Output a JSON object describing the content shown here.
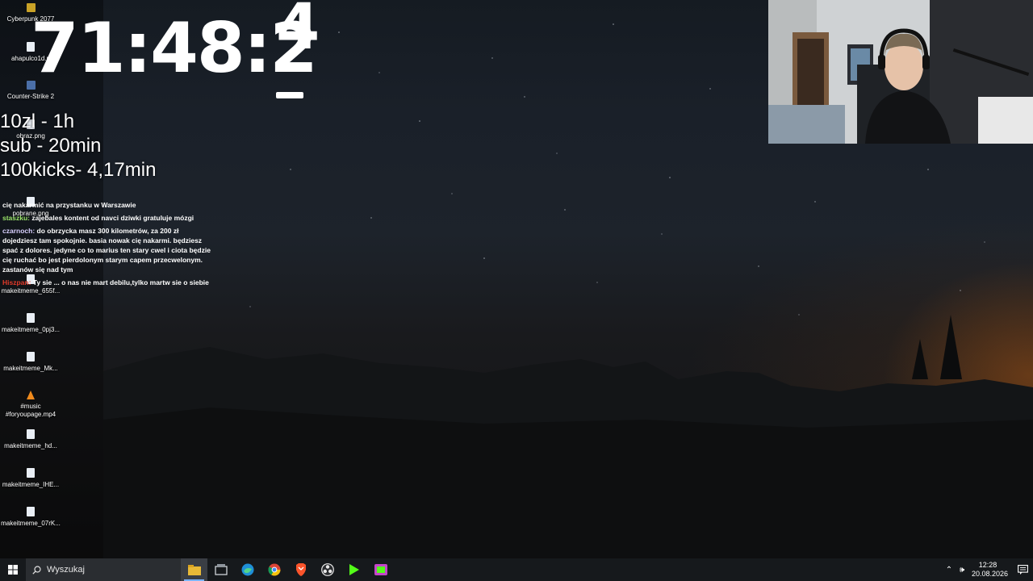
{
  "desktop_icons": [
    {
      "label": "Cyberpunk 2077",
      "icon": "game-icon"
    },
    {
      "label": "ahapulco1d.p",
      "icon": "file-icon"
    },
    {
      "label": "Counter-Strike 2",
      "icon": "cs2-icon"
    },
    {
      "label": "obraz.png",
      "icon": "image-file-icon"
    },
    {
      "label": "pobrane.png",
      "icon": "image-file-icon"
    },
    {
      "label": "makeitmeme_655f...",
      "icon": "image-file-icon"
    },
    {
      "label": "makeitmeme_0pj3...",
      "icon": "image-file-icon"
    },
    {
      "label": "makeitmeme_Mk...",
      "icon": "image-file-icon"
    },
    {
      "label": "#music #foryoupage.mp4",
      "icon": "vlc-icon"
    },
    {
      "label": "makeitmeme_hd...",
      "icon": "image-file-icon"
    },
    {
      "label": "makeitmeme_IHE...",
      "icon": "image-file-icon"
    },
    {
      "label": "makeitmeme_07rK...",
      "icon": "image-file-icon"
    }
  ],
  "overlay": {
    "timer": "71:48:2",
    "timer_last_digit": "4",
    "rates": [
      "10zl - 1h",
      "sub - 20min",
      "100kicks- 4,17min"
    ]
  },
  "chat": [
    {
      "user": "",
      "text": "cię nakarmić na przystanku w Warszawie"
    },
    {
      "user": "staszku:",
      "text": "zajebales kontent od navci dziwki gratuluje mózgi"
    },
    {
      "user": "czarnoch:",
      "text": "do obrzycka masz 300 kilometrów, za 200 zł dojedziesz tam spokojnie. basia nowak cię nakarmi. będziesz spać z dolores. jedyne co to marius ten stary cwel i ciota będzie cię ruchać bo jest pierdolonym starym capem przecwelonym. zastanów się nad tym"
    },
    {
      "user": "Hiszpan:",
      "text": "Ty sie ... o nas nie mart debilu,tylko martw sie o siebie"
    }
  ],
  "taskbar": {
    "search_placeholder": "Wyszukaj",
    "apps": [
      "file-explorer-icon",
      "task-view-icon",
      "edge-icon",
      "chrome-icon",
      "brave-icon",
      "obs-icon",
      "kick-icon",
      "streamer-app-icon"
    ],
    "time": "12:28",
    "date": "20.08.2026"
  },
  "colors": {
    "taskbar": "#16191c",
    "search_box": "#2a2d31",
    "accent": "#7ab4ff",
    "chat_staszku": "#9be56a",
    "chat_hiszpan": "#e23a2a"
  }
}
